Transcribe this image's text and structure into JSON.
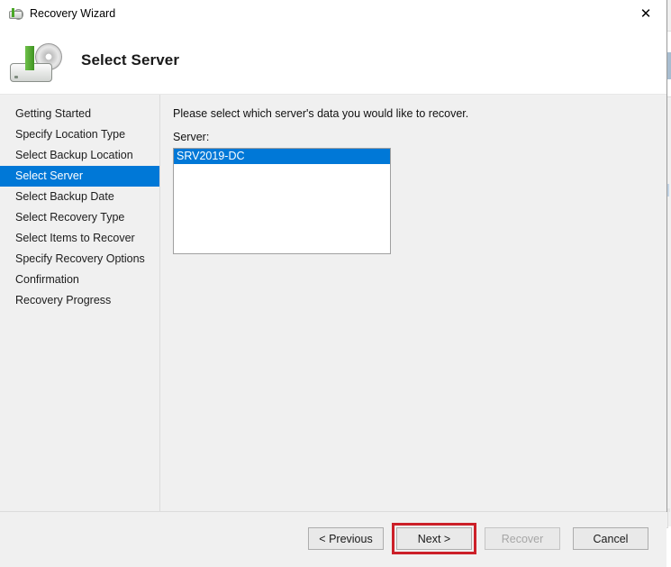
{
  "window": {
    "title": "Recovery Wizard",
    "title_icon": "recovery-disk-icon",
    "close_label": "✕",
    "header_title": "Select Server",
    "header_icon": "recovery-disk-icon"
  },
  "sidebar": {
    "items": [
      {
        "label": "Getting Started",
        "selected": false
      },
      {
        "label": "Specify Location Type",
        "selected": false
      },
      {
        "label": "Select Backup Location",
        "selected": false
      },
      {
        "label": "Select Server",
        "selected": true
      },
      {
        "label": "Select Backup Date",
        "selected": false
      },
      {
        "label": "Select Recovery Type",
        "selected": false
      },
      {
        "label": "Select Items to Recover",
        "selected": false
      },
      {
        "label": "Specify Recovery Options",
        "selected": false
      },
      {
        "label": "Confirmation",
        "selected": false
      },
      {
        "label": "Recovery Progress",
        "selected": false
      }
    ]
  },
  "main": {
    "instruction": "Please select which server's data you would like to recover.",
    "field_label": "Server:",
    "server_list": [
      {
        "name": "SRV2019-DC",
        "selected": true
      }
    ]
  },
  "footer": {
    "previous_label": "< Previous",
    "next_label": "Next >",
    "recover_label": "Recover",
    "cancel_label": "Cancel",
    "recover_disabled": true,
    "next_highlighted": true
  },
  "colors": {
    "selection_blue": "#0078d7",
    "annotation_red": "#cc2029",
    "window_bg": "#f0f0f0",
    "field_bg": "#ffffff"
  }
}
